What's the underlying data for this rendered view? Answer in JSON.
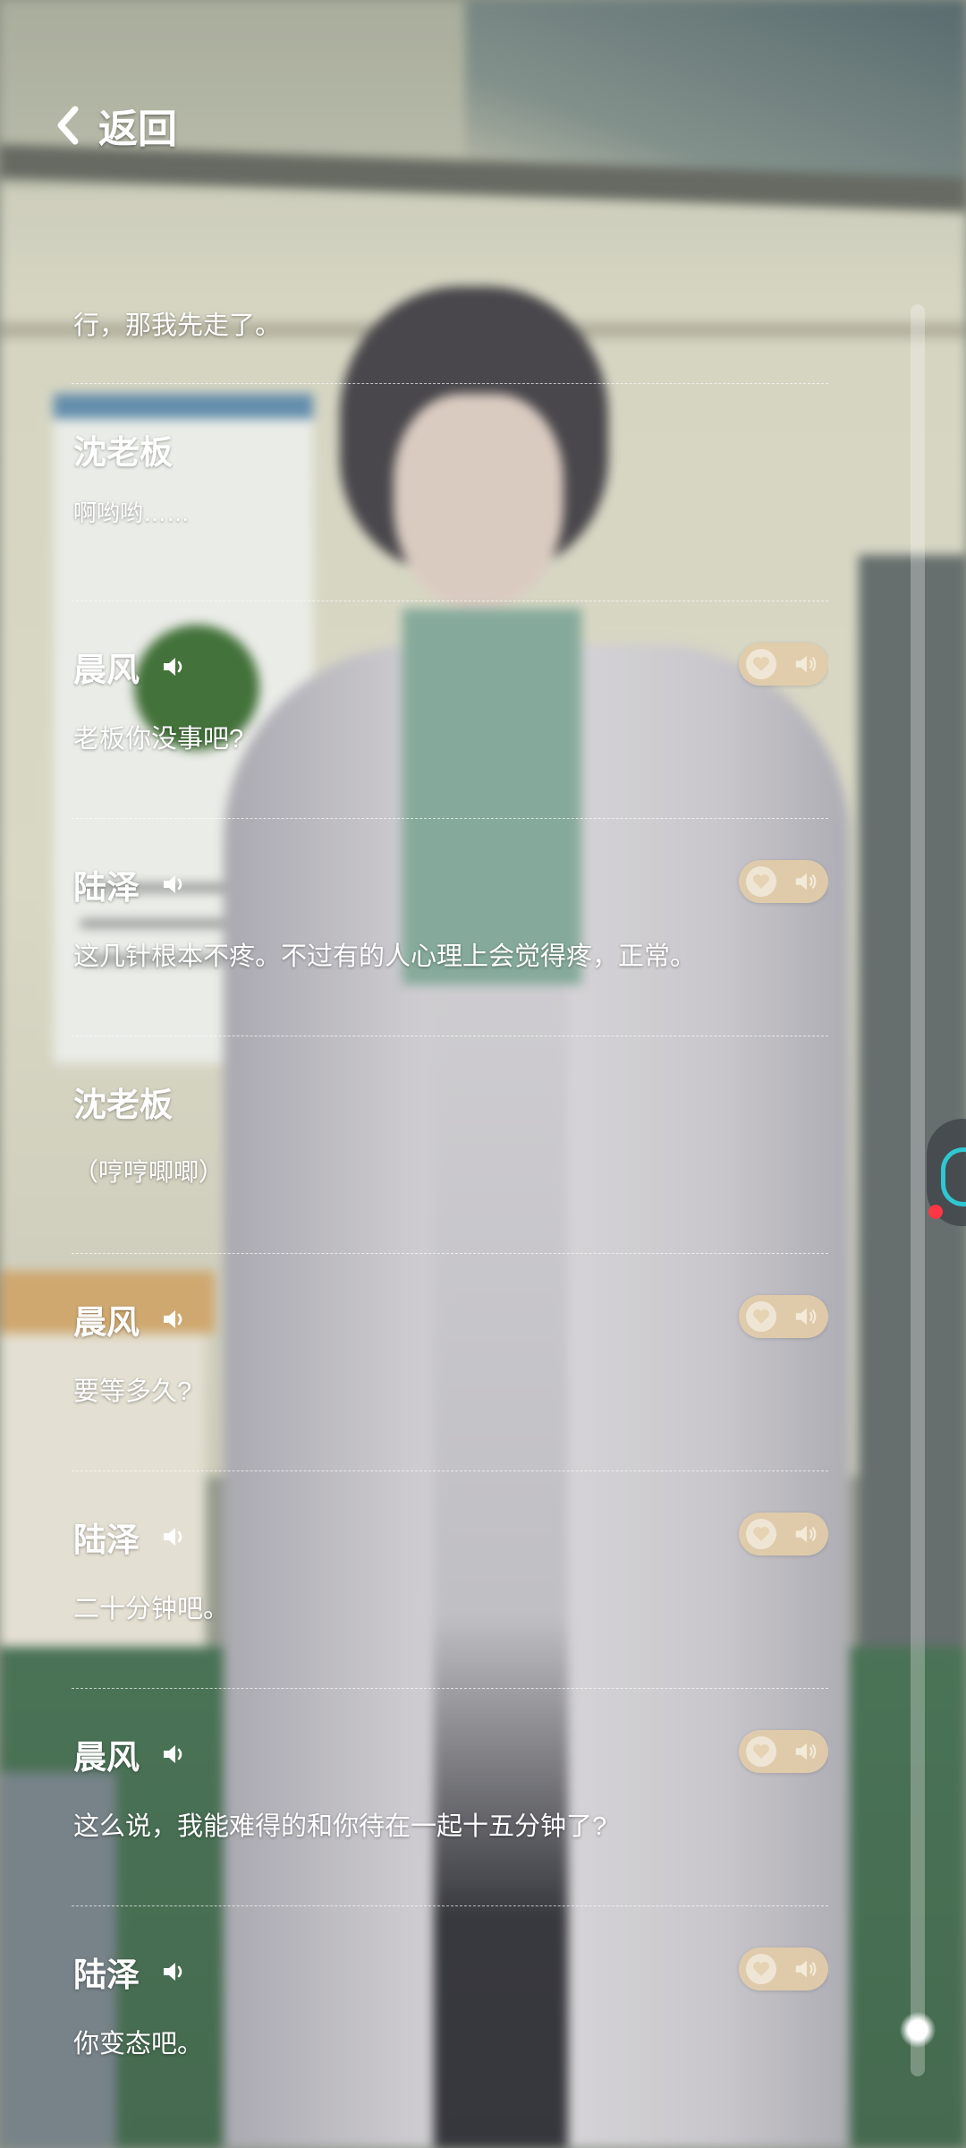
{
  "header": {
    "back_label": "返回",
    "back_icon": "chevron-left-icon"
  },
  "log": {
    "entries": [
      {
        "speaker": "",
        "text": "行，那我先走了。",
        "voice": false
      },
      {
        "speaker": "沈老板",
        "text": "啊哟哟……",
        "voice": false
      },
      {
        "speaker": "晨风",
        "text": "老板你没事吧?",
        "voice": true
      },
      {
        "speaker": "陆泽",
        "text": "这几针根本不疼。不过有的人心理上会觉得疼，正常。",
        "voice": true
      },
      {
        "speaker": "沈老板",
        "text": "（哼哼唧唧）",
        "voice": false
      },
      {
        "speaker": "晨风",
        "text": "要等多久?",
        "voice": true
      },
      {
        "speaker": "陆泽",
        "text": "二十分钟吧。",
        "voice": true
      },
      {
        "speaker": "晨风",
        "text": "这么说，我能难得的和你待在一起十五分钟了?",
        "voice": true
      },
      {
        "speaker": "陆泽",
        "text": "你变态吧。",
        "voice": true
      }
    ]
  },
  "icons": {
    "voice": "speaker-icon",
    "favorite": "heart-icon",
    "replay": "replay-voice-icon"
  },
  "colors": {
    "text": "#ffffff",
    "pill": "#e2cca8",
    "pill_icon": "#f3ead8",
    "accent_cyan": "#2ec7d2",
    "accent_red": "#ff3644"
  },
  "scroll": {
    "position": 1.0
  }
}
